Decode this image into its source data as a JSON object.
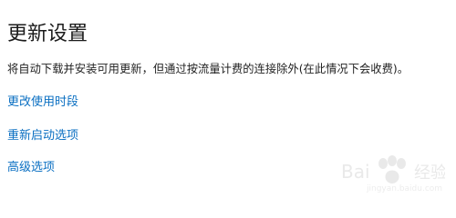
{
  "section": {
    "title": "更新设置",
    "description": "将自动下载并安装可用更新，但通过按流量计费的连接除外(在此情况下会收费)。"
  },
  "links": [
    {
      "label": "更改使用时段"
    },
    {
      "label": "重新启动选项"
    },
    {
      "label": "高级选项"
    }
  ],
  "watermark": {
    "brand": "Baidu 经验",
    "site": "jingyan.baidu.com"
  },
  "colors": {
    "link": "#0a6fc2",
    "text": "#1f1f1f",
    "background": "#ffffff"
  }
}
